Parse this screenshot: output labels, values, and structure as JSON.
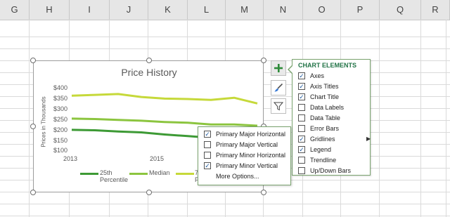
{
  "columns": [
    "G",
    "H",
    "I",
    "J",
    "K",
    "L",
    "M",
    "N",
    "O",
    "P",
    "Q",
    "R"
  ],
  "chart": {
    "title": "Price History",
    "y_axis_title": "Prices in Thousands",
    "y_ticks": [
      "$400",
      "$350",
      "$300",
      "$250",
      "$200",
      "$150",
      "$100"
    ],
    "x_ticks": [
      "2013",
      "2015"
    ],
    "legend": [
      {
        "line1": "25th",
        "line2": "Percentile",
        "color": "#3d9a35"
      },
      {
        "line1": "Median",
        "line2": "",
        "color": "#8cc53f"
      },
      {
        "line1": "7",
        "line2": "P",
        "color": "#c6d93a"
      }
    ]
  },
  "chart_data": {
    "type": "line",
    "title": "Price History",
    "xlabel": "",
    "ylabel": "Prices in Thousands",
    "ylim": [
      100,
      400
    ],
    "x": [
      2013,
      2013.5,
      2014,
      2014.5,
      2015,
      2015.5,
      2016,
      2016.5,
      2017
    ],
    "series": [
      {
        "name": "25th Percentile",
        "color": "#3d9a35",
        "values": [
          198,
          196,
          190,
          186,
          176,
          168,
          160,
          172,
          170
        ]
      },
      {
        "name": "Median",
        "color": "#8cc53f",
        "values": [
          252,
          250,
          246,
          242,
          236,
          232,
          224,
          224,
          218
        ]
      },
      {
        "name": "7",
        "color": "#c6d93a",
        "values": [
          362,
          366,
          370,
          356,
          348,
          346,
          342,
          352,
          325
        ]
      }
    ]
  },
  "side_buttons": {
    "plus": "plus-icon",
    "brush": "paintbrush-icon",
    "filter": "filter-icon"
  },
  "chart_elements": {
    "title": "CHART ELEMENTS",
    "items": [
      {
        "label": "Axes",
        "checked": true
      },
      {
        "label": "Axis Titles",
        "checked": true
      },
      {
        "label": "Chart Title",
        "checked": true
      },
      {
        "label": "Data Labels",
        "checked": false
      },
      {
        "label": "Data Table",
        "checked": false
      },
      {
        "label": "Error Bars",
        "checked": false
      },
      {
        "label": "Gridlines",
        "checked": true,
        "submenu": true
      },
      {
        "label": "Legend",
        "checked": true
      },
      {
        "label": "Trendline",
        "checked": false
      },
      {
        "label": "Up/Down Bars",
        "checked": false
      }
    ]
  },
  "gridlines_menu": {
    "items": [
      {
        "label": "Primary Major Horizontal",
        "checked": true
      },
      {
        "label": "Primary Major Vertical",
        "checked": false
      },
      {
        "label": "Primary Minor Horizontal",
        "checked": false
      },
      {
        "label": "Primary Minor Vertical",
        "checked": true
      }
    ],
    "more_options": "More Options..."
  }
}
